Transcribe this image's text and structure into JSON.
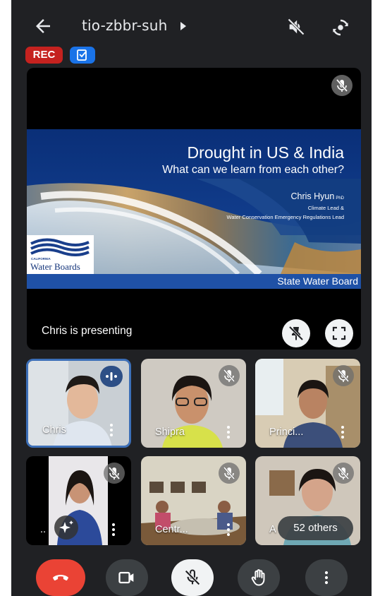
{
  "header": {
    "meeting_code": "tio-zbbr-suh",
    "back_icon": "arrow-back-icon",
    "speaker_icon": "speaker-off-icon",
    "camera_switch_icon": "switch-camera-icon"
  },
  "badges": {
    "rec_label": "REC",
    "notes_icon": "notes-icon"
  },
  "stage": {
    "presenting_text": "Chris is presenting",
    "slide": {
      "title": "Drought in US & India",
      "subtitle": "What can we learn from each other?",
      "presenter": "Chris Hyun",
      "presenter_suffix": "PhD",
      "role_line1": "Climate Lead &",
      "role_line2": "Water Conservation Emergency Regulations Lead",
      "logo_small": "CALIFORNIA",
      "logo_text": "Water Boards",
      "footer": "State Water Board"
    }
  },
  "participants": [
    {
      "name": "Chris",
      "state": "speaking"
    },
    {
      "name": "Shipra",
      "state": "muted"
    },
    {
      "name": "Princi...",
      "state": "muted"
    },
    {
      "name": "..",
      "state": "muted"
    },
    {
      "name": "Centr...",
      "state": "muted"
    },
    {
      "name": "A",
      "state": "muted"
    }
  ],
  "others_label": "52 others",
  "controls": {
    "end_call": "end-call-icon",
    "camera": "video-camera-icon",
    "mic": "mic-off-icon",
    "raise_hand": "raise-hand-icon",
    "more": "more-vertical-icon"
  },
  "colors": {
    "background": "#202124",
    "rec": "#c5221f",
    "end_call": "#ea4335",
    "accent_blue": "#1a73e8",
    "slide_blue": "#0d2e6b"
  }
}
